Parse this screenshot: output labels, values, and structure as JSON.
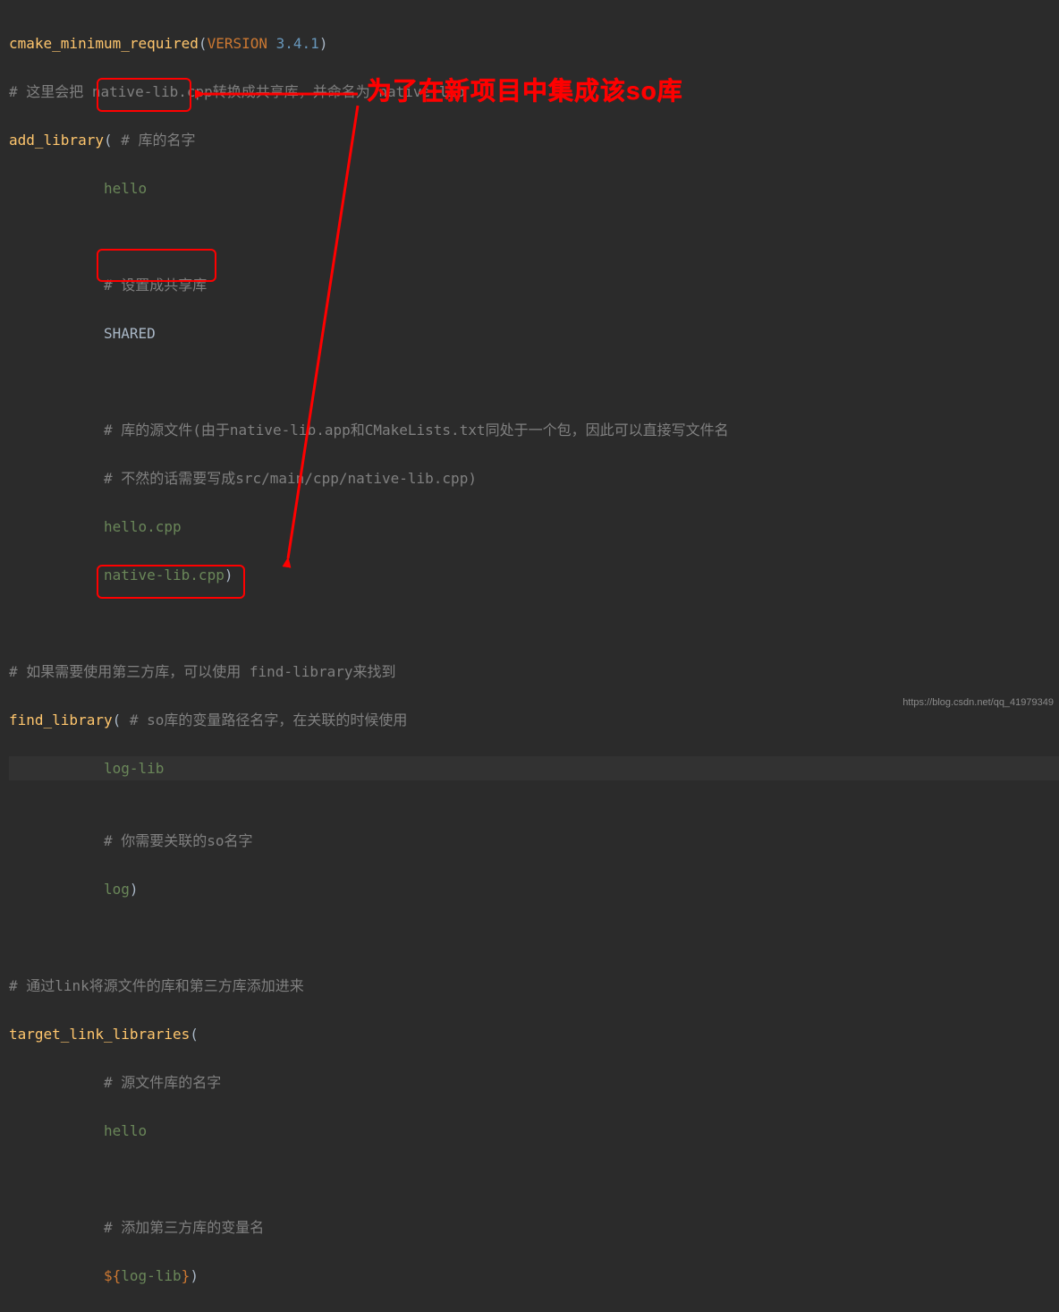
{
  "callout_text": "为了在新项目中集成该so库",
  "watermark": "https://blog.csdn.net/qq_41979349",
  "code": {
    "l1_func": "cmake_minimum_required",
    "l1_open": "(",
    "l1_kw": "VERSION",
    "l1_sp": " ",
    "l1_num": "3.4.1",
    "l1_close": ")",
    "l2_hash": "# ",
    "l2_comment": "这里会把 native-lib.cpp转换成共享库，并命名为 native-lib",
    "l3_func": "add_library",
    "l3_open": "( ",
    "l3_hash": "# ",
    "l3_comment": "库的名字",
    "l4_indent": "           ",
    "l4_ident": "hello",
    "l6_indent": "           ",
    "l6_hash": "# ",
    "l6_comment": "设置成共享库",
    "l7_indent": "           ",
    "l7_kw": "SHARED",
    "l9_indent": "           ",
    "l9_hash": "# ",
    "l9_comment": "库的源文件(由于native-lib.app和CMakeLists.txt同处于一个包，因此可以直接写文件名",
    "l10_indent": "           ",
    "l10_hash": "# ",
    "l10_comment": "不然的话需要写成src/main/cpp/native-lib.cpp)",
    "l11_indent": "           ",
    "l11_ident": "hello.cpp",
    "l12_indent": "           ",
    "l12_ident": "native-lib.cpp",
    "l12_close": ")",
    "l14_hash": "# ",
    "l14_comment": "如果需要使用第三方库，可以使用 find-library来找到",
    "l15_func": "find_library",
    "l15_open": "( ",
    "l15_hash": "# ",
    "l15_comment": "so库的变量路径名字，在关联的时候使用",
    "l16_indent": "           ",
    "l16_ident": "log-lib",
    "l18_indent": "           ",
    "l18_hash": "# ",
    "l18_comment": "你需要关联的so名字",
    "l19_indent": "           ",
    "l19_ident": "log",
    "l19_close": ")",
    "l21_hash": "# ",
    "l21_comment": "通过link将源文件的库和第三方库添加进来",
    "l22_func": "target_link_libraries",
    "l22_open": "(",
    "l23_indent": "           ",
    "l23_hash": "# ",
    "l23_comment": "源文件库的名字",
    "l24_indent": "           ",
    "l24_ident": "hello",
    "l26_indent": "           ",
    "l26_hash": "# ",
    "l26_comment": "添加第三方库的变量名",
    "l27_indent": "           ",
    "l27_var_open": "${",
    "l27_var": "log-lib",
    "l27_var_close": "}",
    "l27_close": ")"
  }
}
